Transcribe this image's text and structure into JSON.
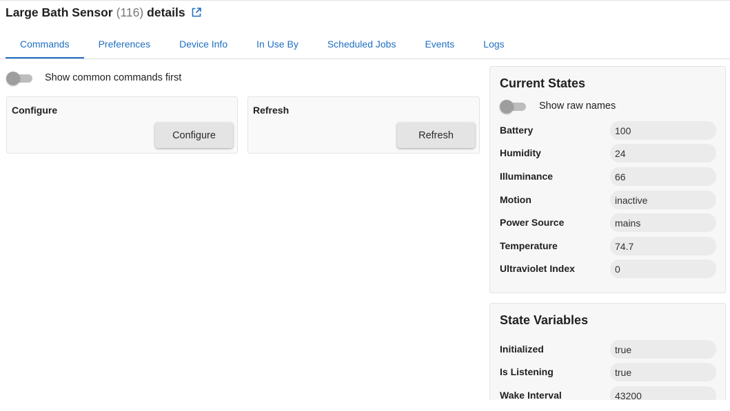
{
  "device": {
    "name": "Large Bath Sensor",
    "id": "(116)",
    "suffix": "details"
  },
  "tabs": [
    {
      "label": "Commands",
      "active": true
    },
    {
      "label": "Preferences",
      "active": false
    },
    {
      "label": "Device Info",
      "active": false
    },
    {
      "label": "In Use By",
      "active": false
    },
    {
      "label": "Scheduled Jobs",
      "active": false
    },
    {
      "label": "Events",
      "active": false
    },
    {
      "label": "Logs",
      "active": false
    }
  ],
  "commands": {
    "common_first_label": "Show common commands first",
    "common_first_on": false,
    "cards": [
      {
        "title": "Configure",
        "button": "Configure"
      },
      {
        "title": "Refresh",
        "button": "Refresh"
      }
    ]
  },
  "current_states": {
    "title": "Current States",
    "raw_names_label": "Show raw names",
    "raw_names_on": false,
    "rows": [
      {
        "name": "Battery",
        "value": "100"
      },
      {
        "name": "Humidity",
        "value": "24"
      },
      {
        "name": "Illuminance",
        "value": "66"
      },
      {
        "name": "Motion",
        "value": "inactive"
      },
      {
        "name": "Power Source",
        "value": "mains"
      },
      {
        "name": "Temperature",
        "value": "74.7"
      },
      {
        "name": "Ultraviolet Index",
        "value": "0"
      }
    ]
  },
  "state_variables": {
    "title": "State Variables",
    "rows": [
      {
        "name": "Initialized",
        "value": "true"
      },
      {
        "name": "Is Listening",
        "value": "true"
      },
      {
        "name": "Wake Interval",
        "value": "43200"
      }
    ]
  },
  "colors": {
    "accent": "#1f6fc1",
    "toggle_off": "#9e9e9e",
    "value_pill": "#ebebeb"
  }
}
